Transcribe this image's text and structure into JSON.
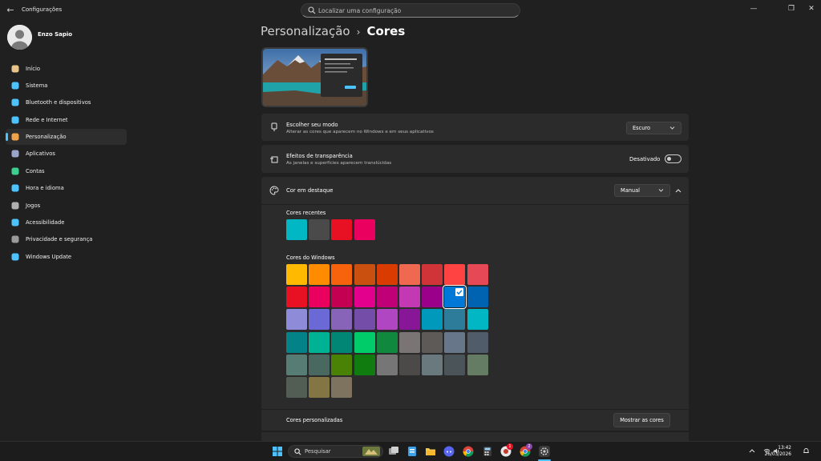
{
  "window": {
    "title": "Configurações",
    "search_placeholder": "Localizar uma configuração",
    "controls": {
      "minimize": "—",
      "maximize": "❐",
      "close": "✕"
    }
  },
  "user": {
    "name": "Enzo Sapio"
  },
  "sidebar": {
    "items": [
      {
        "label": "Início",
        "icon": "home-icon",
        "color": "#e8c38a"
      },
      {
        "label": "Sistema",
        "icon": "system-icon",
        "color": "#4cc2ff"
      },
      {
        "label": "Bluetooth e dispositivos",
        "icon": "bluetooth-icon",
        "color": "#4cc2ff"
      },
      {
        "label": "Rede e Internet",
        "icon": "wifi-icon",
        "color": "#4cc2ff"
      },
      {
        "label": "Personalização",
        "icon": "brush-icon",
        "color": "#f0a24a",
        "active": true
      },
      {
        "label": "Aplicativos",
        "icon": "apps-icon",
        "color": "#9aa6c9"
      },
      {
        "label": "Contas",
        "icon": "account-icon",
        "color": "#3ccf8e"
      },
      {
        "label": "Hora e idioma",
        "icon": "globe-clock-icon",
        "color": "#4cc2ff"
      },
      {
        "label": "Jogos",
        "icon": "gamepad-icon",
        "color": "#b0b0b0"
      },
      {
        "label": "Acessibilidade",
        "icon": "accessibility-icon",
        "color": "#4cc2ff"
      },
      {
        "label": "Privacidade e segurança",
        "icon": "shield-icon",
        "color": "#9a9a9a"
      },
      {
        "label": "Windows Update",
        "icon": "update-icon",
        "color": "#4cc2ff"
      }
    ]
  },
  "main": {
    "breadcrumb": {
      "parent": "Personalização",
      "separator": "›",
      "current": "Cores"
    },
    "mode": {
      "title": "Escolher seu modo",
      "subtitle": "Alterar as cores que aparecem no Windows e em seus aplicativos",
      "value": "Escuro"
    },
    "transparency": {
      "title": "Efeitos de transparência",
      "subtitle": "As janelas e superfícies aparecem translúcidas",
      "state_label": "Desativado",
      "on": false
    },
    "accent": {
      "title": "Cor em destaque",
      "value": "Manual",
      "recent_label": "Cores recentes",
      "recent_colors": [
        "#00b7c3",
        "#4a4a4a",
        "#e81123",
        "#ea005e"
      ],
      "windows_label": "Cores do Windows",
      "windows_colors": [
        "#ffb900",
        "#ff8c00",
        "#f7630c",
        "#ca5010",
        "#da3b01",
        "#ef6950",
        "#d13438",
        "#ff4343",
        "#e74856",
        "#e81123",
        "#ea005e",
        "#c30052",
        "#e3008c",
        "#bf0077",
        "#c239b3",
        "#9a0089",
        "#0078d7",
        "#0063b1",
        "#8e8cd8",
        "#6b69d6",
        "#8764b8",
        "#744da9",
        "#b146c2",
        "#881798",
        "#0099bc",
        "#2d7d9a",
        "#00b7c3",
        "#038387",
        "#00b294",
        "#018574",
        "#00cc6a",
        "#10893e",
        "#7a7574",
        "#5d5a58",
        "#68768a",
        "#515c6b",
        "#567c73",
        "#486860",
        "#498205",
        "#107c10",
        "#767676",
        "#4c4a48",
        "#69797e",
        "#4a5459",
        "#647c64",
        "#525e54",
        "#847545",
        "#7e735f"
      ],
      "selected_index": 16,
      "custom_label": "Cores personalizadas",
      "custom_button": "Mostrar as cores"
    }
  },
  "taskbar": {
    "search_placeholder": "Pesquisar",
    "badges": {
      "app1": "1",
      "app2": "2"
    },
    "time": "13:42",
    "date": "26/03/2026"
  }
}
